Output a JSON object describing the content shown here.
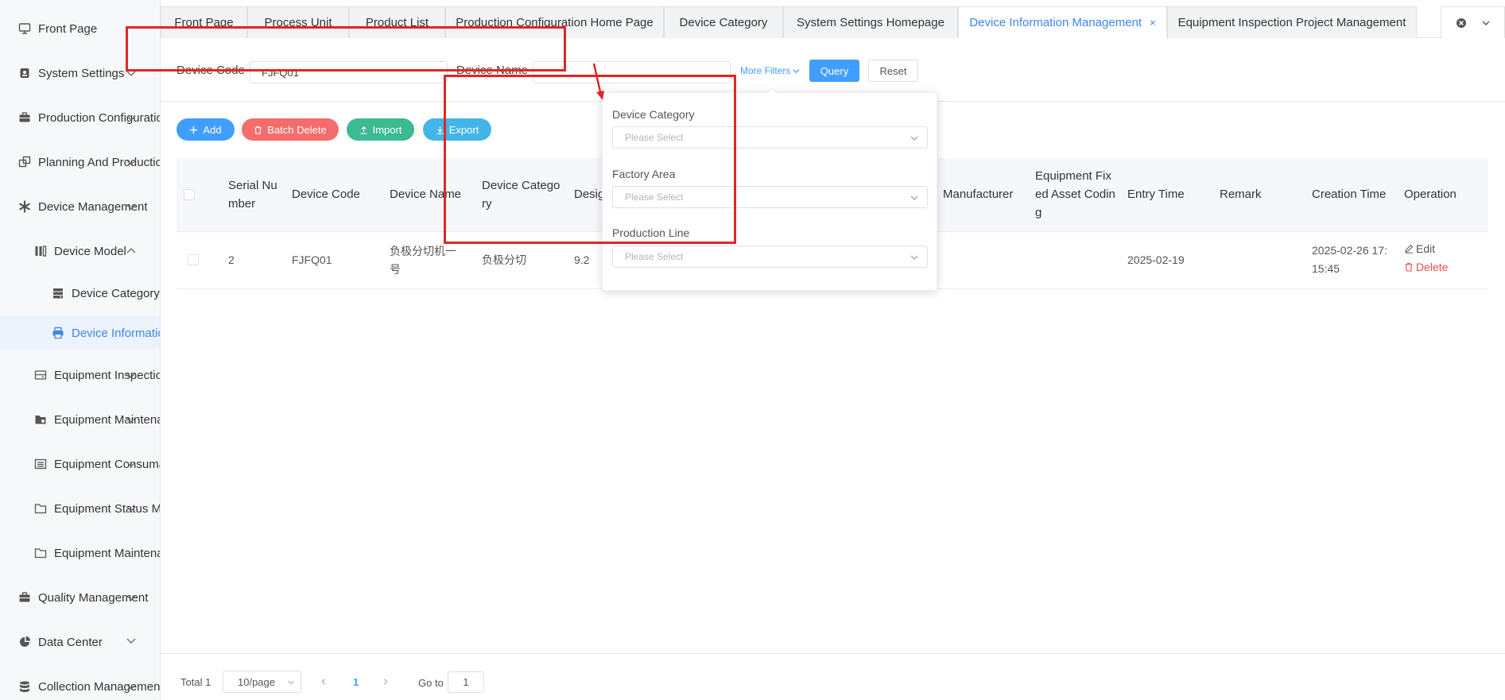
{
  "sidebar": {
    "items": [
      {
        "label": "Front Page",
        "icon": "monitor-icon"
      },
      {
        "label": "System Settings",
        "icon": "lock-icon"
      },
      {
        "label": "Production Configuration",
        "icon": "briefcase-icon"
      },
      {
        "label": "Planning And Production",
        "icon": "copy-icon"
      },
      {
        "label": "Device Management",
        "icon": "asterisk-icon"
      },
      {
        "label": "Device Model",
        "icon": "columns-icon"
      },
      {
        "label": "Device Category",
        "icon": "server-icon"
      },
      {
        "label": "Device Information",
        "icon": "printer-icon"
      },
      {
        "label": "Equipment Inspection",
        "icon": "drive-icon"
      },
      {
        "label": "Equipment Maintenance",
        "icon": "folder-gear-icon"
      },
      {
        "label": "Equipment Consumables",
        "icon": "list-icon"
      },
      {
        "label": "Equipment Status Ma",
        "icon": "folder-icon"
      },
      {
        "label": "Equipment Maintenance",
        "icon": "folder-icon"
      },
      {
        "label": "Quality Management",
        "icon": "briefcase-icon"
      },
      {
        "label": "Data Center",
        "icon": "pie-icon"
      },
      {
        "label": "Collection Management",
        "icon": "database-icon"
      }
    ]
  },
  "tabs": [
    {
      "label": "Front Page"
    },
    {
      "label": "Process Unit"
    },
    {
      "label": "Product List"
    },
    {
      "label": "Production Configuration Home Page"
    },
    {
      "label": "Device Category"
    },
    {
      "label": "System Settings Homepage"
    },
    {
      "label": "Device Information Management",
      "active": true
    },
    {
      "label": "Equipment Inspection Project Management"
    }
  ],
  "tab_close": "×",
  "filters": {
    "device_code_label": "Device Code",
    "device_code_value": "FJFQ01",
    "device_name_label": "Device Name",
    "device_name_value": "",
    "more_filters": "More Filters",
    "query": "Query",
    "reset": "Reset"
  },
  "popover": {
    "device_category_label": "Device Category",
    "factory_area_label": "Factory Area",
    "production_line_label": "Production Line",
    "placeholder": "Please Select"
  },
  "actions": {
    "add": "Add",
    "batch_delete": "Batch Delete",
    "import": "Import",
    "export": "Export"
  },
  "table": {
    "headers": {
      "serial_1": "Serial Nu",
      "serial_2": "mber",
      "device_code": "Device Code",
      "device_name": "Device Name",
      "category_1": "Device Catego",
      "category_2": "ry",
      "design": "Desig",
      "manufacturer": "Manufacturer",
      "asset_1": "Equipment Fix",
      "asset_2": "ed Asset Codin",
      "asset_3": "g",
      "entry_time": "Entry Time",
      "remark": "Remark",
      "creation_time": "Creation Time",
      "operation": "Operation"
    },
    "row": {
      "serial": "2",
      "device_code": "FJFQ01",
      "device_name_1": "负极分切机一",
      "device_name_2": "号",
      "category": "负极分切",
      "design": "9.2",
      "entry_time": "2025-02-19",
      "creation_time_1": "2025-02-26 17:",
      "creation_time_2": "15:45",
      "edit": "Edit",
      "delete": "Delete"
    }
  },
  "pagination": {
    "total": "Total 1",
    "page_size": "10/page",
    "current_page": "1",
    "goto_label": "Go to",
    "goto_value": "1"
  },
  "colors": {
    "primary": "#409eff",
    "danger": "#f56c6c",
    "success": "#3cba92",
    "info": "#43b5e8",
    "annotation": "#e02626"
  }
}
